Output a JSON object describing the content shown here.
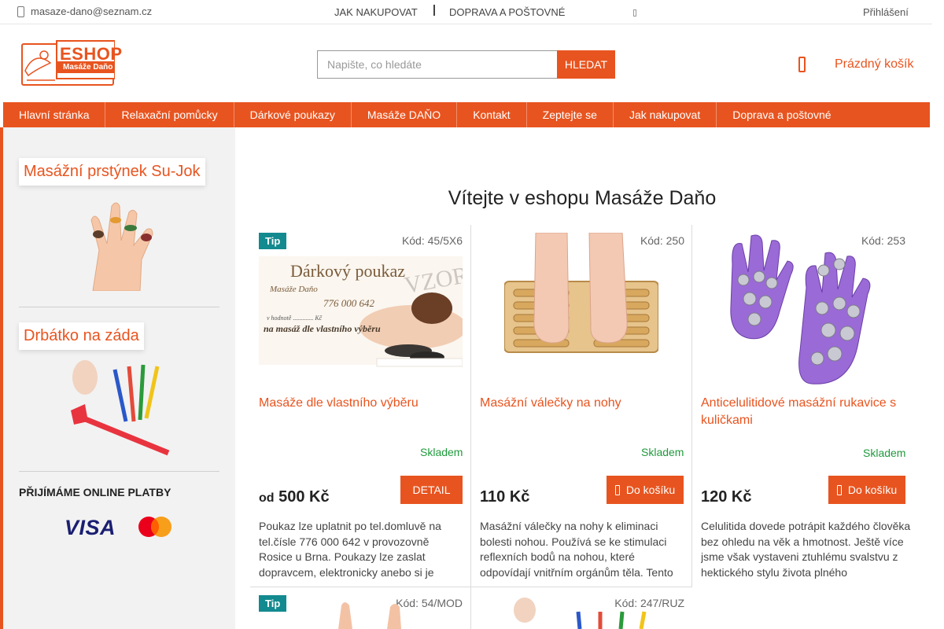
{
  "topbar": {
    "email": "masaze-dano@seznam.cz",
    "links": [
      "JAK NAKUPOVAT",
      "DOPRAVA A POŠTOVNÉ"
    ],
    "login": "Přihlášení"
  },
  "header": {
    "logo_text": "ESHOP",
    "logo_subtext": "Masáže Daňo",
    "search_placeholder": "Napište, co hledáte",
    "search_button": "HLEDAT",
    "cart": "Prázdný košík"
  },
  "nav": [
    "Hlavní stránka",
    "Relaxační pomůcky",
    "Dárkové poukazy",
    "Masáže DAŇO",
    "Kontakt",
    "Zeptejte se",
    "Jak nakupovat",
    "Doprava a poštovné"
  ],
  "sidebar": {
    "boxes": [
      {
        "title": "Masážní prstýnek Su-Jok"
      },
      {
        "title": "Drbátko na záda"
      }
    ],
    "payments_title": "PŘIJÍMÁME ONLINE PLATBY",
    "visa": "VISA"
  },
  "main": {
    "welcome": "Vítejte v eshopu Masáže Daňo",
    "products": [
      {
        "tip": "Tip",
        "code": "Kód: 45/5X6",
        "name": "Masáže dle vlastního výběru",
        "stock": "Skladem",
        "price_prefix": "od",
        "price": "500 Kč",
        "button": "DETAIL",
        "desc": "Poukaz lze uplatnit po tel.domluvě na tel.čísle 776 000 642 v provozovně Rosice u Brna. Poukazy lze zaslat dopravcem, elektronicky anebo si je"
      },
      {
        "code": "Kód: 250",
        "name": "Masážní válečky na nohy",
        "stock": "Skladem",
        "price": "110 Kč",
        "button": "Do košíku",
        "desc": "Masážní válečky na nohy k eliminaci bolesti nohou. Používá se ke stimulaci reflexních bodů na nohou, které odpovídají vnitřním orgánům těla. Tento"
      },
      {
        "code": "Kód: 253",
        "name": "Anticelulitidové masážní rukavice s kuličkami",
        "stock": "Skladem",
        "price": "120 Kč",
        "button": "Do košíku",
        "desc": "Celulitida dovede potrápit každého člověka bez ohledu na věk a hmotnost. Ještě více jsme však vystaveni ztuhlému svalstvu z hektického stylu života plného"
      },
      {
        "tip": "Tip",
        "code": "Kód: 54/MOD"
      },
      {
        "code": "Kód: 247/RUZ"
      }
    ],
    "voucher_image_text": {
      "title": "Dárkový poukaz",
      "subtitle": "Masáže Daňo",
      "phone": "776 000 642",
      "line1": "v hodnotě ............. Kč",
      "line2": "na masáž dle vlastního výběru",
      "watermark": "VZOR"
    }
  },
  "colors": {
    "accent": "#e8541f",
    "tip": "#128a8f",
    "stock": "#1f9a3c"
  }
}
